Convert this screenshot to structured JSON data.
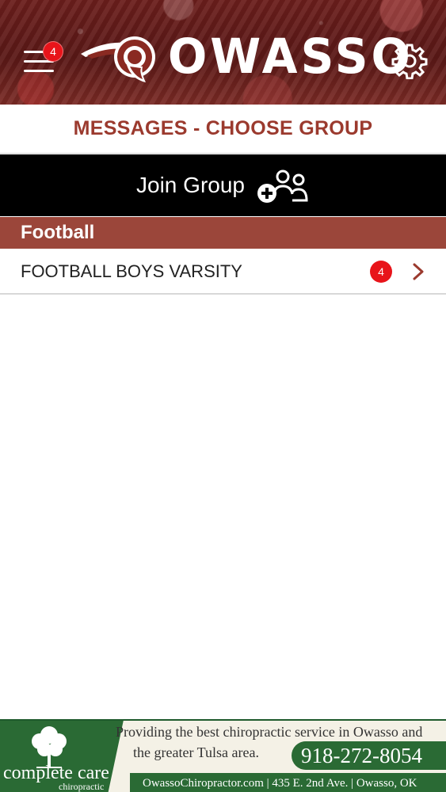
{
  "header": {
    "menu_badge": "4",
    "brand": "OWASSO"
  },
  "page": {
    "title": "MESSAGES - CHOOSE GROUP"
  },
  "join": {
    "label": "Join Group"
  },
  "groups": [
    {
      "section": "Football",
      "items": [
        {
          "label": "FOOTBALL BOYS VARSITY",
          "badge": "4"
        }
      ]
    }
  ],
  "ad": {
    "brand": "complete care",
    "sub": "chiropractic",
    "tagline_1": "Providing the best chiropractic service in Owasso and",
    "tagline_2": "the greater Tulsa area.",
    "phone": "918-272-8054",
    "footer": "OwassoChiropractor.com | 435 E. 2nd Ave. | Owasso, OK"
  },
  "colors": {
    "header_bg": "#6b1e1c",
    "title_text": "#9b3a2e",
    "section_bg": "#9b463a",
    "badge": "#e8141a",
    "ad_green": "#2a6a34"
  }
}
